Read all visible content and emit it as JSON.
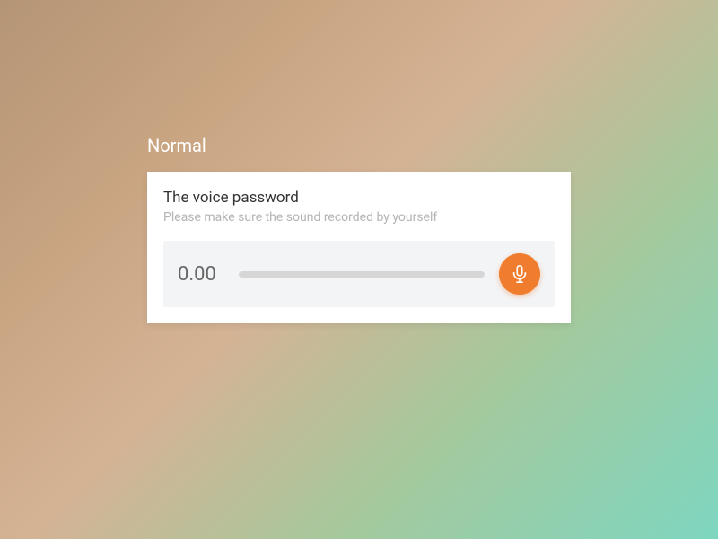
{
  "section": {
    "label": "Normal"
  },
  "card": {
    "title": "The voice password",
    "subtitle": "Please make sure the sound recorded by yourself"
  },
  "recorder": {
    "timer": "0.00",
    "mic_icon": "microphone-icon"
  },
  "colors": {
    "accent": "#f07c2e",
    "card_bg": "#ffffff",
    "recorder_bg": "#f3f4f6",
    "track": "#d6d6d6"
  }
}
